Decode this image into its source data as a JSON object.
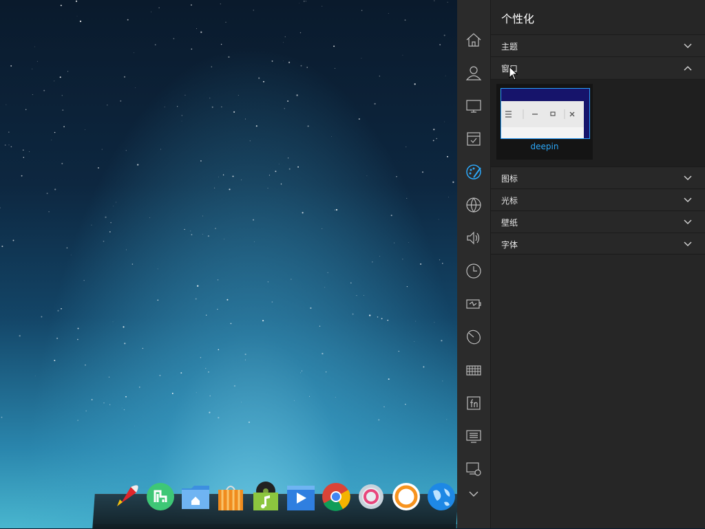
{
  "desktop": {
    "dock_apps": [
      {
        "name": "launcher",
        "icon": "rocket-icon"
      },
      {
        "name": "deepin-store",
        "icon": "store-icon"
      },
      {
        "name": "file-manager",
        "icon": "folder-home-icon"
      },
      {
        "name": "app-store",
        "icon": "shopping-bag-icon"
      },
      {
        "name": "music",
        "icon": "music-icon"
      },
      {
        "name": "movie",
        "icon": "video-icon"
      },
      {
        "name": "chrome",
        "icon": "chrome-icon"
      },
      {
        "name": "settings",
        "icon": "gear-icon"
      },
      {
        "name": "deepin-screenshot",
        "icon": "orange-ring-icon"
      },
      {
        "name": "browser",
        "icon": "globe-icon"
      }
    ]
  },
  "control_center": {
    "nav_icons": [
      "home-icon",
      "account-icon",
      "display-icon",
      "default-apps-icon",
      "personalization-icon",
      "network-icon",
      "sound-icon",
      "time-icon",
      "power-icon",
      "mouse-icon",
      "keyboard-icon",
      "fn-icon",
      "update-icon",
      "system-info-icon",
      "more-icon"
    ],
    "active_nav": "personalization-icon",
    "title": "个性化",
    "sections": {
      "theme": "主题",
      "window": "窗口",
      "icon": "图标",
      "cursor": "光标",
      "wallpaper": "壁纸",
      "font": "字体"
    },
    "window_themes": [
      {
        "name": "deepin",
        "selected": true
      }
    ]
  },
  "colors": {
    "accent": "#2ca7f8",
    "panel_bg": "#262626",
    "nav_bg": "#2b2b2b"
  }
}
